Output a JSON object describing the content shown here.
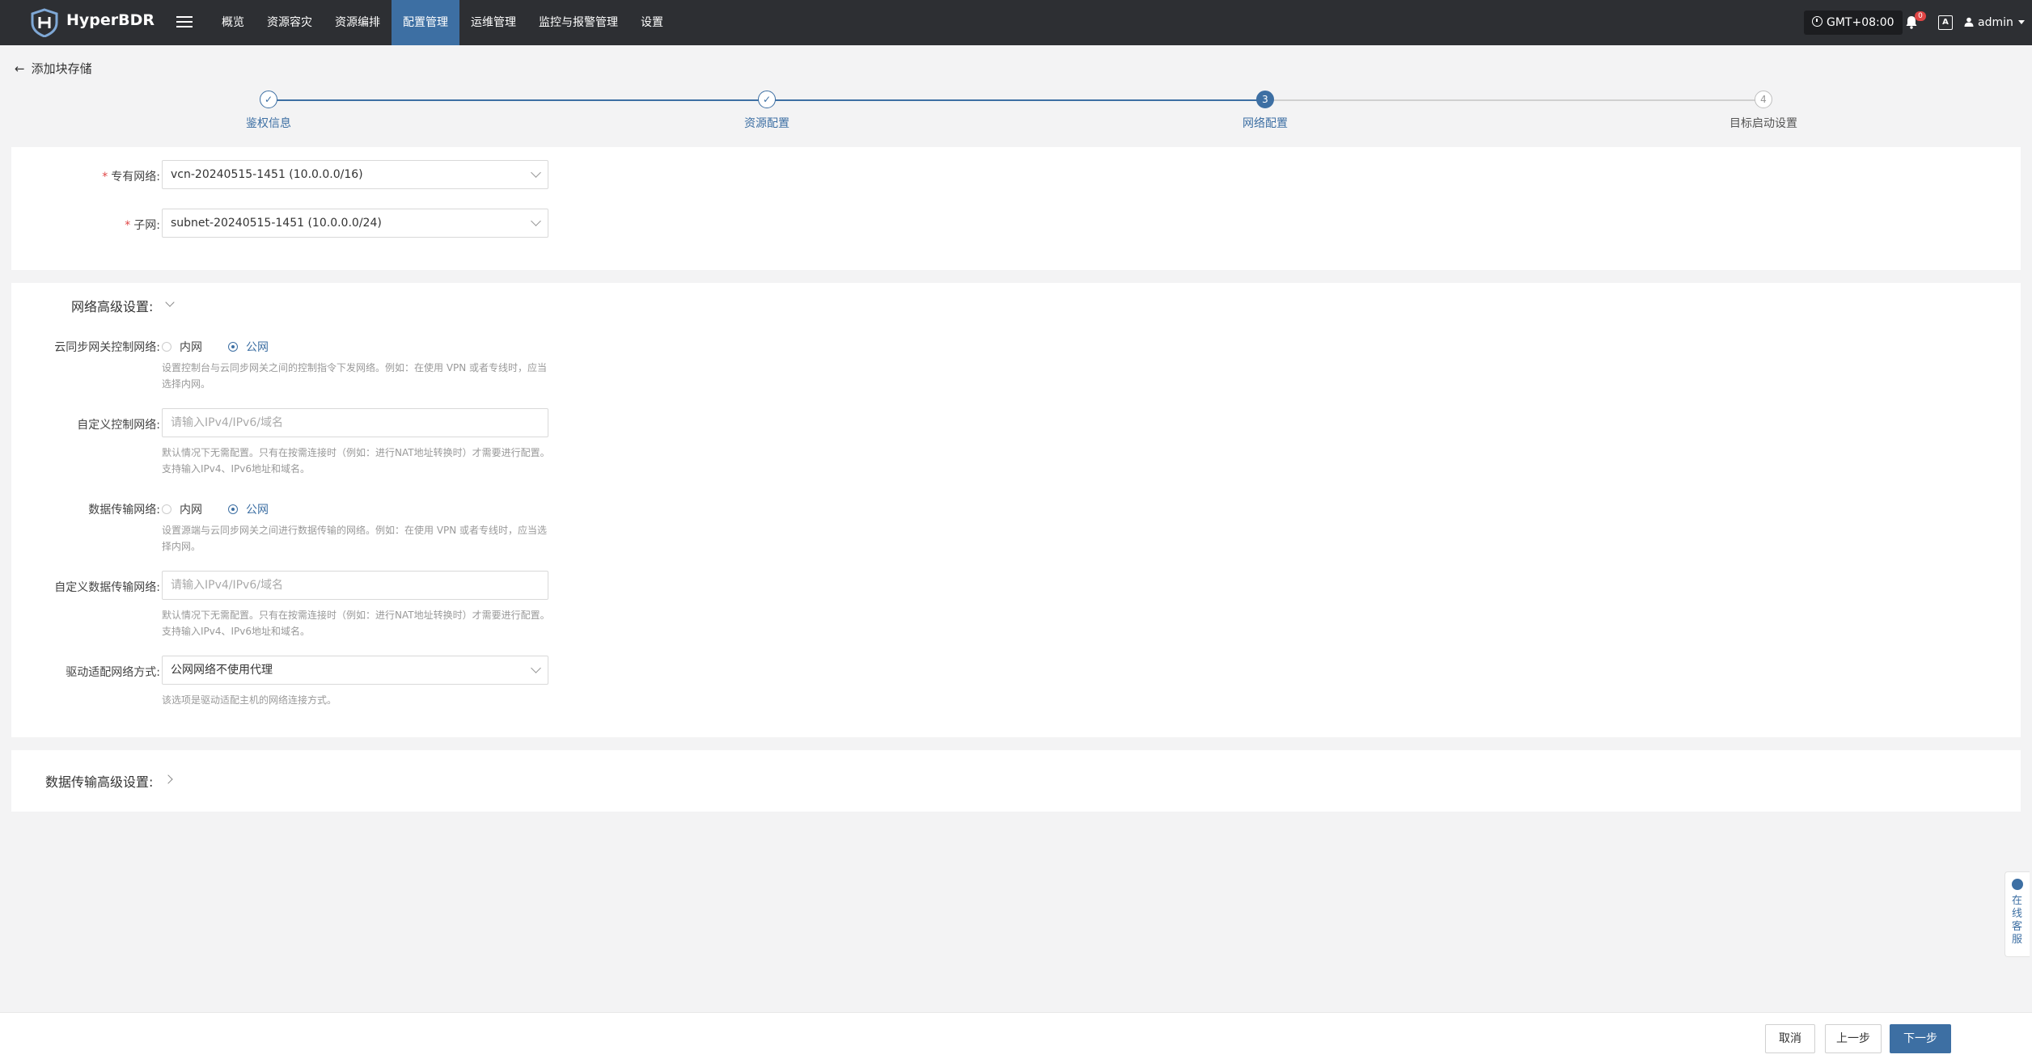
{
  "app": {
    "brand": "HyperBDR"
  },
  "nav": {
    "items": [
      {
        "label": "概览",
        "active": false
      },
      {
        "label": "资源容灾",
        "active": false
      },
      {
        "label": "资源编排",
        "active": false
      },
      {
        "label": "配置管理",
        "active": true
      },
      {
        "label": "运维管理",
        "active": false
      },
      {
        "label": "监控与报警管理",
        "active": false
      },
      {
        "label": "设置",
        "active": false
      }
    ],
    "timezone": "GMT+08:00",
    "notification_count": "0",
    "lang_icon": "A",
    "user": "admin"
  },
  "page": {
    "back_label": "添加块存储"
  },
  "steps": [
    {
      "label": "鉴权信息",
      "state": "done",
      "number": "1"
    },
    {
      "label": "资源配置",
      "state": "done",
      "number": "2"
    },
    {
      "label": "网络配置",
      "state": "current",
      "number": "3"
    },
    {
      "label": "目标启动设置",
      "state": "todo",
      "number": "4"
    }
  ],
  "network": {
    "vpc_label": "专有网络:",
    "vpc_value": "vcn-20240515-1451 (10.0.0.0/16)",
    "subnet_label": "子网:",
    "subnet_value": "subnet-20240515-1451 (10.0.0.0/24)"
  },
  "advanced": {
    "title": "网络高级设置:",
    "control_net": {
      "label": "云同步网关控制网络:",
      "option_internal": "内网",
      "option_public": "公网",
      "selected": "公网",
      "help": "设置控制台与云同步网关之间的控制指令下发网络。例如：在使用 VPN 或者专线时，应当选择内网。"
    },
    "custom_control": {
      "label": "自定义控制网络:",
      "placeholder": "请输入IPv4/IPv6/域名",
      "help": "默认情况下无需配置。只有在按需连接时（例如：进行NAT地址转换时）才需要进行配置。支持输入IPv4、IPv6地址和域名。"
    },
    "data_net": {
      "label": "数据传输网络:",
      "option_internal": "内网",
      "option_public": "公网",
      "selected": "公网",
      "help": "设置源端与云同步网关之间进行数据传输的网络。例如：在使用 VPN 或者专线时，应当选择内网。"
    },
    "custom_data": {
      "label": "自定义数据传输网络:",
      "placeholder": "请输入IPv4/IPv6/域名",
      "help": "默认情况下无需配置。只有在按需连接时（例如：进行NAT地址转换时）才需要进行配置。支持输入IPv4、IPv6地址和域名。"
    },
    "driver_net": {
      "label": "驱动适配网络方式:",
      "value": "公网网络不使用代理",
      "help": "该选项是驱动适配主机的网络连接方式。"
    }
  },
  "data_transfer": {
    "title": "数据传输高级设置:"
  },
  "footer": {
    "cancel": "取消",
    "prev": "上一步",
    "next": "下一步"
  },
  "service": {
    "label": "在线客服"
  },
  "colors": {
    "accent": "#3d6fa3",
    "topbar": "#2d2f33",
    "required": "#e04545"
  }
}
